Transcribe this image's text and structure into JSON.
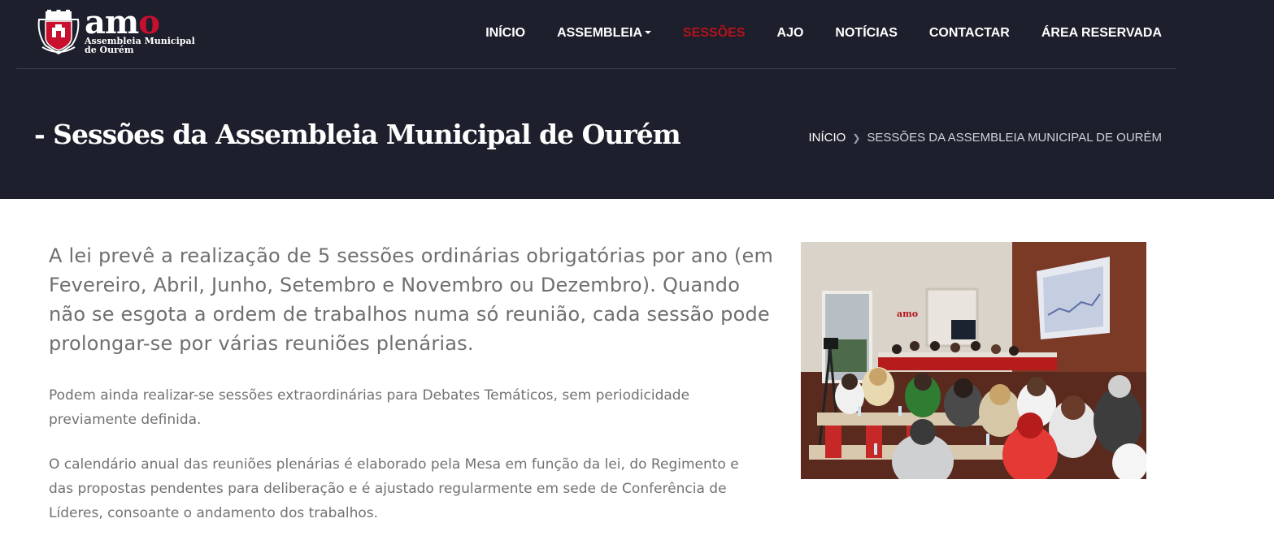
{
  "brand": {
    "word_part1": "am",
    "word_part2": "o",
    "subtitle_line1": "Assembleia Municipal",
    "subtitle_line2": "de Ourém"
  },
  "nav": {
    "items": [
      {
        "label": "INÍCIO"
      },
      {
        "label": "ASSEMBLEIA"
      },
      {
        "label": "SESSÕES"
      },
      {
        "label": "AJO"
      },
      {
        "label": "NOTÍCIAS"
      },
      {
        "label": "CONTACTAR"
      },
      {
        "label": "ÁREA RESERVADA"
      }
    ],
    "active_index": 2
  },
  "page": {
    "title": "- Sessões da Assembleia Municipal de Ourém"
  },
  "breadcrumb": {
    "home": "INÍCIO",
    "current": "SESSÕES DA ASSEMBLEIA MUNICIPAL DE OURÉM"
  },
  "content": {
    "lead": "A lei prevê a realização de 5 sessões ordinárias obrigatórias por ano (em Fevereiro, Abril, Junho, Setembro e Novembro ou Dezembro). Quando não se esgota a ordem de trabalhos numa só reunião, cada sessão pode prolongar-se por várias reuniões plenárias.",
    "paragraph1": "Podem ainda realizar-se sessões extraordinárias para Debates Temáticos, sem periodicidade previamente definida.",
    "paragraph2": "O calendário anual das reuniões plenárias é elaborado pela Mesa em função da lei, do Regimento e das propostas pendentes para deliberação e é ajustado regularmente em sede de Conferência de Líderes, consoante o andamento dos trabalhos."
  },
  "photo": {
    "sign_text": "amo"
  },
  "colors": {
    "header_bg": "#1d1f2c",
    "accent_red": "#b5121b",
    "body_text": "#727272"
  }
}
